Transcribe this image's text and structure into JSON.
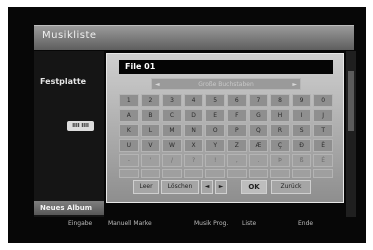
{
  "screen": {
    "title": "Musikliste",
    "left_label": "Festplatte",
    "left_chip": "IIII IIII",
    "new_album": "Neues Album",
    "footer": [
      "Eingabe",
      "Manuell Marke",
      "Musik Prog.",
      "Liste",
      "Ende"
    ]
  },
  "dialog": {
    "name_value": "File 01",
    "mode_value": "Große Buchstaben",
    "keys": [
      [
        "1",
        "2",
        "3",
        "4",
        "5",
        "6",
        "7",
        "8",
        "9",
        "0"
      ],
      [
        "A",
        "B",
        "C",
        "D",
        "E",
        "F",
        "G",
        "H",
        "I",
        "J"
      ],
      [
        "K",
        "L",
        "M",
        "N",
        "O",
        "P",
        "Q",
        "R",
        "S",
        "T"
      ],
      [
        "U",
        "V",
        "W",
        "X",
        "Y",
        "Z",
        "Æ",
        "Ç",
        "Ð",
        "È"
      ],
      [
        "-",
        "'",
        "/",
        "?",
        "!",
        ",",
        ".",
        "Þ",
        "ß",
        "É"
      ],
      [
        "",
        "",
        "",
        "",
        "",
        "",
        "",
        "",
        "",
        ""
      ]
    ],
    "actions": {
      "leer": "Leer",
      "loeschen": "Löschen",
      "left": "◄",
      "right": "►",
      "ok": "OK",
      "zurueck": "Zurück"
    }
  }
}
